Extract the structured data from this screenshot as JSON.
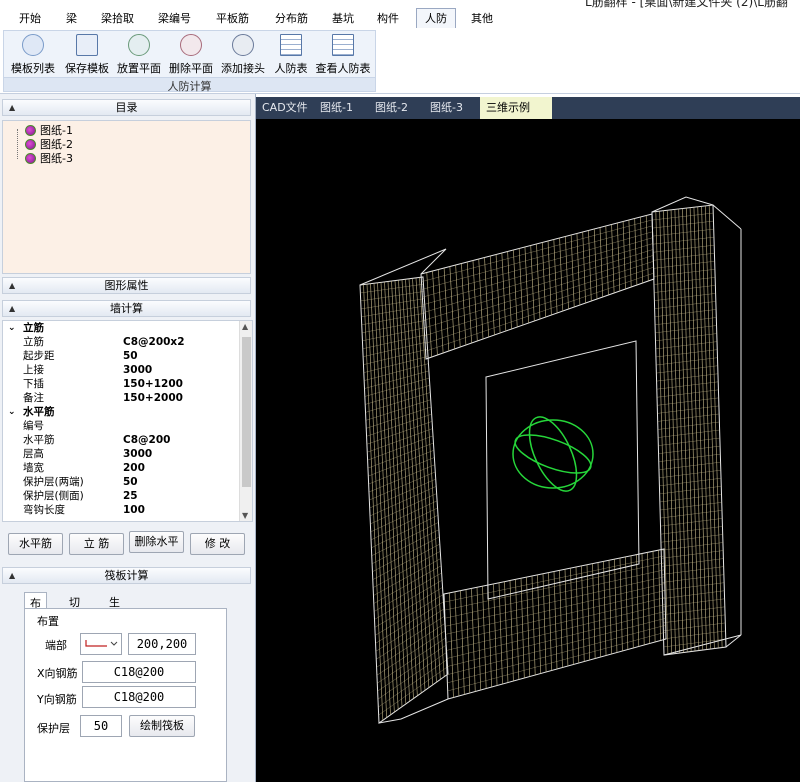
{
  "title": {
    "text": "L筋翻样 - [桌面\\新建文件夹 (2)\\L筋翻"
  },
  "menu": {
    "items": [
      "开始",
      "梁",
      "梁拾取",
      "梁编号",
      "平板筋",
      "分布筋",
      "基坑",
      "构件",
      "人防",
      "其他"
    ],
    "active_index": 8
  },
  "ribbon": {
    "group_title": "人防计算",
    "buttons": [
      {
        "label": "模板列表",
        "icon": "list-icon"
      },
      {
        "label": "保存模板",
        "icon": "save-template-icon"
      },
      {
        "label": "放置平面",
        "icon": "place-plane-icon"
      },
      {
        "label": "删除平面",
        "icon": "delete-plane-icon"
      },
      {
        "label": "添加接头",
        "icon": "add-joint-icon"
      },
      {
        "label": "人防表",
        "icon": "table-icon"
      },
      {
        "label": "查看人防表",
        "icon": "view-table-icon"
      }
    ]
  },
  "left_panel": {
    "catalog_title": "目录",
    "tree": [
      "图纸-1",
      "图纸-2",
      "图纸-3"
    ],
    "shape_props_title": "图形属性",
    "wall_calc_title": "墙计算",
    "properties": [
      {
        "category": "立筋"
      },
      {
        "key": "立筋",
        "value": "C8@200x2"
      },
      {
        "key": "起步距",
        "value": "50"
      },
      {
        "key": "上接",
        "value": "3000"
      },
      {
        "key": "下插",
        "value": "150+1200  150+2000"
      },
      {
        "key": "备注",
        "value": ""
      },
      {
        "category": "水平筋"
      },
      {
        "key": "编号",
        "value": ""
      },
      {
        "key": "水平筋",
        "value": "C8@200"
      },
      {
        "key": "层高",
        "value": "3000"
      },
      {
        "key": "墙宽",
        "value": "200"
      },
      {
        "key": "保护层(两端)",
        "value": "50"
      },
      {
        "key": "保护层(侧面)",
        "value": "25"
      },
      {
        "key": "弯钩长度",
        "value": "100"
      }
    ],
    "buttons": [
      "水平筋",
      "立 筋",
      "删除水平",
      "修 改"
    ],
    "raft_calc_title": "筏板计算",
    "subtabs": [
      "布置",
      "切割",
      "生成"
    ],
    "group_label": "布置",
    "end_label": "端部",
    "end_value": "200,200",
    "x_label": "X向钢筋",
    "x_value": "C18@200",
    "y_label": "Y向钢筋",
    "y_value": "C18@200",
    "cover_label": "保护层",
    "cover_value": "50",
    "draw_button": "绘制筏板"
  },
  "viewport": {
    "tabs": [
      "CAD文件",
      "图纸-1",
      "图纸-2",
      "图纸-3",
      "三维示例"
    ],
    "active_tab_index": 4,
    "close_label": "×",
    "colors": {
      "background": "#000000",
      "rebar": "#c9bc8e",
      "outline": "#e6e6e6",
      "gizmo": "#26d63a"
    }
  }
}
